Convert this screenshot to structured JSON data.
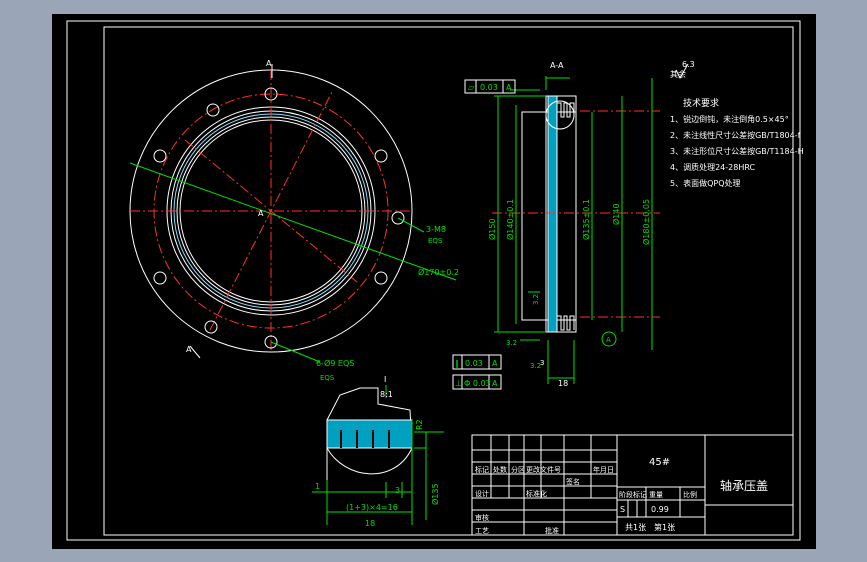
{
  "section_label": "A-A",
  "center_label": "A",
  "view_arrows": [
    "A",
    "A"
  ],
  "roughness_main": "6.3",
  "roughness_rest": "其余",
  "notes": {
    "title": "技术要求",
    "items": [
      "1、锐边倒钝，未注倒角0.5×45°",
      "2、未注线性尺寸公差按GB/T1804-f",
      "3、未注形位尺寸公差按GB/T1184-H",
      "4、调质处理24-28HRC",
      "5、表面做QPQ处理"
    ]
  },
  "front_view": {
    "hole_tapped": "3-M8",
    "hole_tapped_eq": "EQS",
    "bolt_circle": "Ø170±0.2",
    "holes_clear": "6-Ø9 EQS",
    "holes_clear_eq": "EQS"
  },
  "section_view": {
    "flatness": {
      "symbol": "⏥",
      "value": "0.03",
      "datum": "A"
    },
    "dim_d1": "Ø150",
    "dim_d2": "Ø140±0.1",
    "dim_d3": "Ø135±0.1",
    "dim_d4": "Ø140",
    "dim_d5": "Ø180±0.05",
    "rough_a": "3.2",
    "rough_b": "3.2",
    "rough_c": "3.2",
    "datum": "A",
    "dim_w": "18",
    "dim_small": "3"
  },
  "tolerances": [
    {
      "symbol": "∥",
      "value": "0.03",
      "datum": "A"
    },
    {
      "symbol": "⊥",
      "value": "Φ 0.03",
      "datum": "A"
    }
  ],
  "detail": {
    "scale_num": "I",
    "scale_den": "8:1",
    "r_label": "R2",
    "dim_1": "1",
    "dim_3": "3",
    "dim_sum": "(1+3)×4=16",
    "dim_18": "18",
    "dim_dia": "Ø135"
  },
  "title_block": {
    "material": "45#",
    "part_name": "轴承压盖",
    "headers": [
      "标记",
      "处数",
      "分区",
      "更改文件号",
      "签名",
      "年月日"
    ],
    "row_labels": [
      "设计",
      "标准化",
      "审核",
      "工艺",
      "批准"
    ],
    "stage_label": "阶段标记",
    "weight_label": "重量",
    "scale_label": "比例",
    "stage_value": "S",
    "weight_value": "0.99",
    "sheets_total": "共1张",
    "sheet_no": "第1张"
  }
}
